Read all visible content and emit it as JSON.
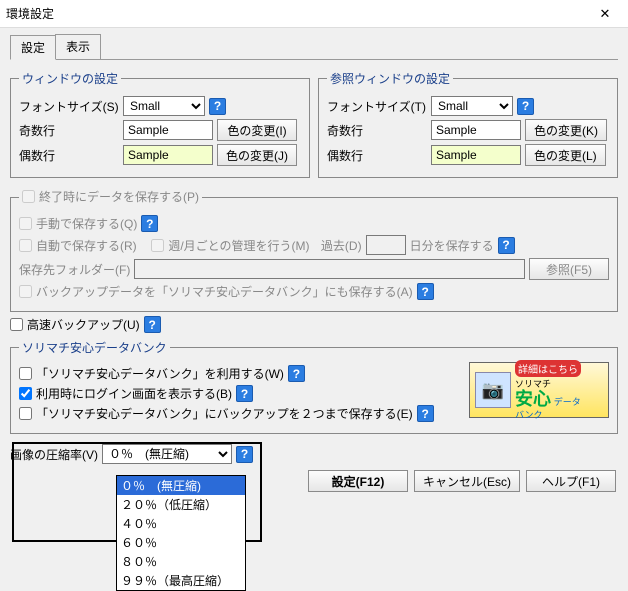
{
  "title": "環境設定",
  "tabs": {
    "active": "設定",
    "other": "表示"
  },
  "window_settings": {
    "legend": "ウィンドウの設定",
    "font_label": "フォントサイズ(S)",
    "font_value": "Small",
    "odd_label": "奇数行",
    "odd_sample": "Sample",
    "odd_btn": "色の変更(I)",
    "even_label": "偶数行",
    "even_sample": "Sample",
    "even_btn": "色の変更(J)"
  },
  "ref_settings": {
    "legend": "参照ウィンドウの設定",
    "font_label": "フォントサイズ(T)",
    "font_value": "Small",
    "odd_label": "奇数行",
    "odd_sample": "Sample",
    "odd_btn": "色の変更(K)",
    "even_label": "偶数行",
    "even_sample": "Sample",
    "even_btn": "色の変更(L)"
  },
  "save_on_exit": {
    "group_label": "終了時にデータを保存する(P)",
    "manual": "手動で保存する(Q)",
    "auto": "自動で保存する(R)",
    "weekly": "週/月ごとの管理を行う(M)",
    "past": "過去(D)",
    "days_suffix": "日分を保存する",
    "folder_label": "保存先フォルダー(F)",
    "browse": "参照(F5)",
    "also_bank": "バックアップデータを「ソリマチ安心データバンク」にも保存する(A)"
  },
  "fast_backup": "高速バックアップ(U)",
  "databank": {
    "legend": "ソリマチ安心データバンク",
    "use": "「ソリマチ安心データバンク」を利用する(W)",
    "login": "利用時にログイン画面を表示する(B)",
    "two_copies": "「ソリマチ安心データバンク」にバックアップを２つまで保存する(E)"
  },
  "ad": {
    "tag": "詳細はこちら",
    "brand": "ソリマチ",
    "big": "安心",
    "sub": "データ\nバンク"
  },
  "compression": {
    "label": "画像の圧縮率(V)",
    "value": "０％　(無圧縮)",
    "options": [
      "０％　(無圧縮)",
      "２０％（低圧縮）",
      "４０％",
      "６０％",
      "８０％",
      "９９％（最高圧縮）"
    ]
  },
  "buttons": {
    "set": "設定(F12)",
    "cancel": "キャンセル(Esc)",
    "help": "ヘルプ(F1)"
  },
  "glyph": {
    "help": "?",
    "close": "✕",
    "cam": "📷"
  }
}
